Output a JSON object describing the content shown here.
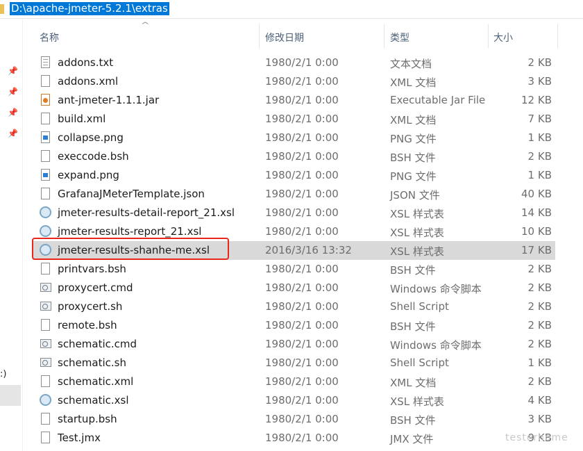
{
  "address_bar": {
    "path": "D:\\apache-jmeter-5.2.1\\extras"
  },
  "left_pane": {
    "pins": [
      "pin",
      "pin",
      "pin",
      "pin"
    ],
    "label": ":)"
  },
  "columns": {
    "name": "名称",
    "date": "修改日期",
    "type": "类型",
    "size": "大小"
  },
  "files": [
    {
      "name": "addons.txt",
      "date": "1980/2/1 0:00",
      "type": "文本文档",
      "size": "2 KB",
      "icon": "txt"
    },
    {
      "name": "addons.xml",
      "date": "1980/2/1 0:00",
      "type": "XML 文档",
      "size": "3 KB",
      "icon": "doc"
    },
    {
      "name": "ant-jmeter-1.1.1.jar",
      "date": "1980/2/1 0:00",
      "type": "Executable Jar File",
      "size": "12 KB",
      "icon": "jar"
    },
    {
      "name": "build.xml",
      "date": "1980/2/1 0:00",
      "type": "XML 文档",
      "size": "7 KB",
      "icon": "doc"
    },
    {
      "name": "collapse.png",
      "date": "1980/2/1 0:00",
      "type": "PNG 文件",
      "size": "1 KB",
      "icon": "png"
    },
    {
      "name": "execcode.bsh",
      "date": "1980/2/1 0:00",
      "type": "BSH 文件",
      "size": "2 KB",
      "icon": "doc"
    },
    {
      "name": "expand.png",
      "date": "1980/2/1 0:00",
      "type": "PNG 文件",
      "size": "1 KB",
      "icon": "png"
    },
    {
      "name": "GrafanaJMeterTemplate.json",
      "date": "1980/2/1 0:00",
      "type": "JSON 文件",
      "size": "40 KB",
      "icon": "doc"
    },
    {
      "name": "jmeter-results-detail-report_21.xsl",
      "date": "1980/2/1 0:00",
      "type": "XSL 样式表",
      "size": "14 KB",
      "icon": "xsl"
    },
    {
      "name": "jmeter-results-report_21.xsl",
      "date": "1980/2/1 0:00",
      "type": "XSL 样式表",
      "size": "10 KB",
      "icon": "xsl"
    },
    {
      "name": "jmeter-results-shanhe-me.xsl",
      "date": "2016/3/16 13:32",
      "type": "XSL 样式表",
      "size": "17 KB",
      "icon": "xsl",
      "selected": true
    },
    {
      "name": "printvars.bsh",
      "date": "1980/2/1 0:00",
      "type": "BSH 文件",
      "size": "2 KB",
      "icon": "doc"
    },
    {
      "name": "proxycert.cmd",
      "date": "1980/2/1 0:00",
      "type": "Windows 命令脚本",
      "size": "2 KB",
      "icon": "cmd"
    },
    {
      "name": "proxycert.sh",
      "date": "1980/2/1 0:00",
      "type": "Shell Script",
      "size": "2 KB",
      "icon": "cmd"
    },
    {
      "name": "remote.bsh",
      "date": "1980/2/1 0:00",
      "type": "BSH 文件",
      "size": "2 KB",
      "icon": "doc"
    },
    {
      "name": "schematic.cmd",
      "date": "1980/2/1 0:00",
      "type": "Windows 命令脚本",
      "size": "2 KB",
      "icon": "cmd"
    },
    {
      "name": "schematic.sh",
      "date": "1980/2/1 0:00",
      "type": "Shell Script",
      "size": "1 KB",
      "icon": "cmd"
    },
    {
      "name": "schematic.xml",
      "date": "1980/2/1 0:00",
      "type": "XML 文档",
      "size": "2 KB",
      "icon": "doc"
    },
    {
      "name": "schematic.xsl",
      "date": "1980/2/1 0:00",
      "type": "XSL 样式表",
      "size": "4 KB",
      "icon": "xsl"
    },
    {
      "name": "startup.bsh",
      "date": "1980/2/1 0:00",
      "type": "BSH 文件",
      "size": "3 KB",
      "icon": "doc"
    },
    {
      "name": "Test.jmx",
      "date": "1980/2/1 0:00",
      "type": "JMX 文件",
      "size": "9 KB",
      "icon": "doc"
    }
  ],
  "watermark": "testerhome",
  "colors": {
    "selection": "#0078d7",
    "highlight_box": "#e8261c",
    "selected_row": "#d9d9d9"
  }
}
